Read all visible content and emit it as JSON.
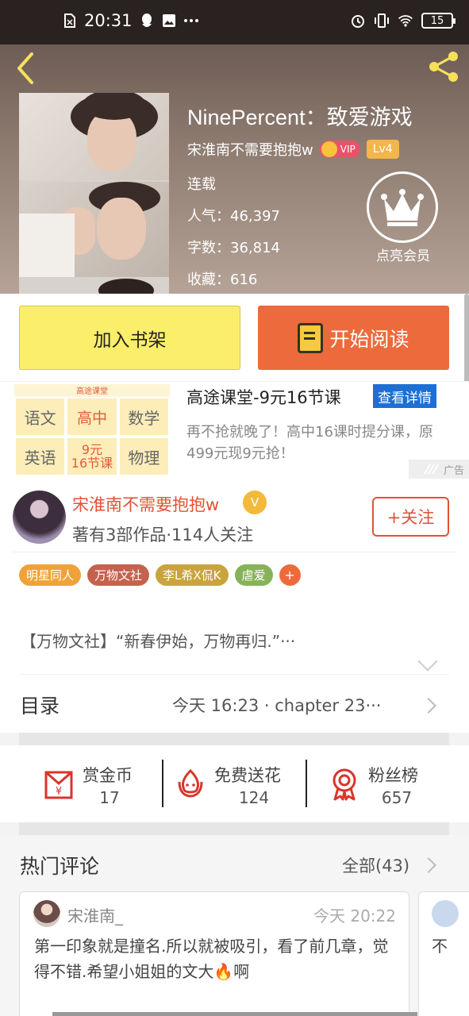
{
  "status_bar": {
    "time": "20:31",
    "battery": "15",
    "icons": [
      "sim-icon",
      "qq-icon",
      "image-icon",
      "more-dots-icon",
      "alarm-icon",
      "vibrate-icon",
      "wifi-icon",
      "battery-icon"
    ]
  },
  "header": {
    "book_title": "NinePercent：致爱游戏",
    "author": "宋淮南不需要抱抱w",
    "vip_label": "VIP",
    "level": "Lv4",
    "status": "连载",
    "popularity": "人气：46,397",
    "word_count": "字数：36,814",
    "favorites": "收藏：616",
    "member_label": "点亮会员"
  },
  "actions": {
    "add_shelf": "加入书架",
    "start_reading": "开始阅读"
  },
  "ad": {
    "brand": "高途课堂",
    "cells": [
      "语文",
      "高中",
      "数学",
      "英语",
      "9元\n16节课",
      "物理"
    ],
    "title": "高途课堂-9元16节课",
    "detail_button": "查看详情",
    "description": "再不抢就晚了！高中16课时提分课，原499元现9元抢！",
    "ad_tag": "广告"
  },
  "author_section": {
    "name": "宋淮南不需要抱抱w",
    "v_badge": "V",
    "stats": "著有3部作品·114人关注",
    "follow_button": "+关注",
    "tags": [
      {
        "label": "明星同人",
        "color": "#f0a23a"
      },
      {
        "label": "万物文社",
        "color": "#c5624e"
      },
      {
        "label": "李L希X侃K",
        "color": "#c9a43e"
      },
      {
        "label": "虐爱",
        "color": "#86b35a"
      }
    ],
    "tag_more": "+",
    "intro": "【万物文社】“新春伊始，万物再归.”···"
  },
  "toc": {
    "title": "目录",
    "latest": "今天 16:23 · chapter 23···"
  },
  "stats": {
    "reward": {
      "label": "赏金币",
      "value": "17"
    },
    "flowers": {
      "label": "免费送花",
      "value": "124"
    },
    "fans": {
      "label": "粉丝榜",
      "value": "657"
    }
  },
  "comments": {
    "title": "热门评论",
    "all": "全部(43)",
    "items": [
      {
        "user": "宋淮南_",
        "time": "今天 20:22",
        "text": "第一印象就是撞名.所以就被吸引，看了前几章，觉得不错.希望小姐姐的文大🔥啊"
      },
      {
        "user": "",
        "time": "",
        "text": "不"
      }
    ]
  },
  "colors": {
    "accent_orange": "#ec6a3c",
    "shelf_yellow": "#fbee6a",
    "author_red": "#e15235",
    "ad_blue": "#1d6fd3"
  }
}
